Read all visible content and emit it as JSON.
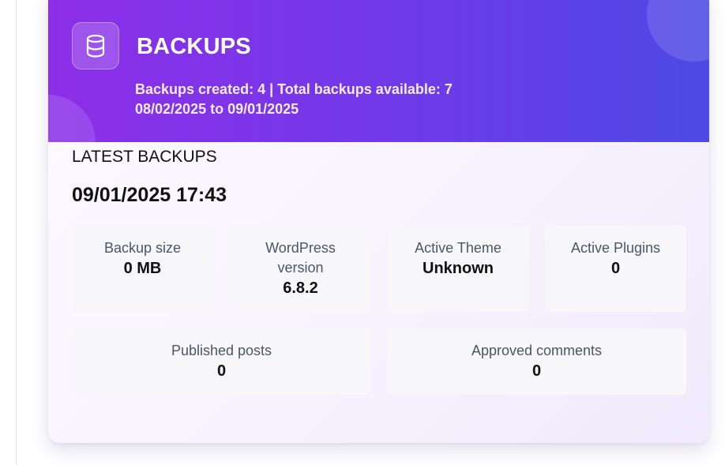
{
  "header": {
    "icon": "database-icon",
    "title": "BACKUPS",
    "summary": "Backups created: 4 | Total backups available: 7",
    "date_range": "08/02/2025 to 09/01/2025",
    "gradient_start": "#8d2ee8",
    "gradient_end": "#4d4ae6"
  },
  "latest": {
    "section_label": "LATEST BACKUPS",
    "timestamp": "09/01/2025 17:43"
  },
  "stats": {
    "backup_size": {
      "label": "Backup size",
      "value": "0 MB"
    },
    "wp_version": {
      "label_line1": "WordPress",
      "label_line2": "version",
      "value": "6.8.2"
    },
    "active_theme": {
      "label": "Active Theme",
      "value": "Unknown"
    },
    "active_plugins": {
      "label": "Active Plugins",
      "value": "0"
    },
    "published_posts": {
      "label": "Published posts",
      "value": "0"
    },
    "approved_comments": {
      "label": "Approved comments",
      "value": "0"
    }
  }
}
